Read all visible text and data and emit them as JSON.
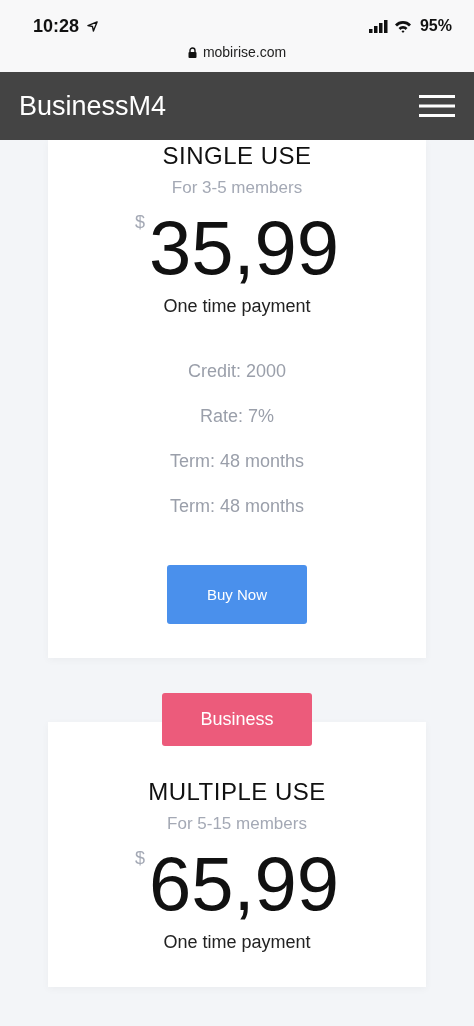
{
  "status_bar": {
    "time": "10:28",
    "battery": "95%"
  },
  "browser": {
    "url": "mobirise.com"
  },
  "navbar": {
    "brand": "BusinessM4"
  },
  "plans": [
    {
      "title": "SINGLE USE",
      "subtitle": "For 3-5 members",
      "currency": "$",
      "price": "35,99",
      "period": "One time payment",
      "features": [
        "Credit: 2000",
        "Rate: 7%",
        "Term: 48 months",
        "Term: 48 months"
      ],
      "button": "Buy Now"
    },
    {
      "badge": "Business",
      "title": "MULTIPLE USE",
      "subtitle": "For 5-15 members",
      "currency": "$",
      "price": "65,99",
      "period": "One time payment"
    }
  ]
}
